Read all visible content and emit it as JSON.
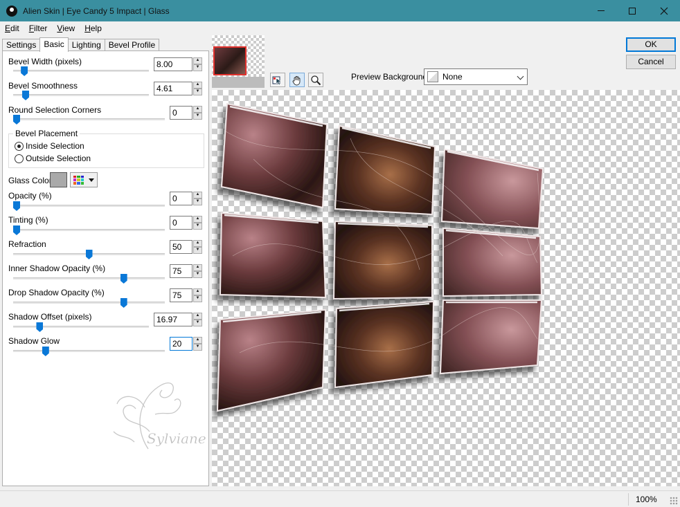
{
  "window": {
    "title": "Alien Skin | Eye Candy 5 Impact | Glass",
    "colors": {
      "titlebar": "#3a8fa0",
      "accent": "#0078d7",
      "thumb_selection": "#e2312d"
    }
  },
  "menu": [
    {
      "key": "E",
      "rest": "dit"
    },
    {
      "key": "F",
      "rest": "ilter"
    },
    {
      "key": "V",
      "rest": "iew"
    },
    {
      "key": "H",
      "rest": "elp"
    }
  ],
  "tabs": [
    "Settings",
    "Basic",
    "Lighting",
    "Bevel Profile"
  ],
  "active_tab": "Basic",
  "controls": {
    "bevel_width": {
      "label": "Bevel Width (pixels)",
      "value": "8.00",
      "level": 0.06
    },
    "bevel_smoothness": {
      "label": "Bevel Smoothness",
      "value": "4.61",
      "level": 0.07
    },
    "round_corners": {
      "label": "Round Selection Corners",
      "value": "0",
      "level": 0.0
    },
    "opacity": {
      "label": "Opacity (%)",
      "value": "0",
      "level": 0.0
    },
    "tinting": {
      "label": "Tinting (%)",
      "value": "0",
      "level": 0.0
    },
    "refraction": {
      "label": "Refraction",
      "value": "50",
      "level": 0.5
    },
    "inner_shadow": {
      "label": "Inner Shadow Opacity (%)",
      "value": "75",
      "level": 0.74
    },
    "drop_shadow": {
      "label": "Drop Shadow Opacity (%)",
      "value": "75",
      "level": 0.74
    },
    "shadow_offset": {
      "label": "Shadow Offset (pixels)",
      "value": "16.97",
      "level": 0.18
    },
    "shadow_glow": {
      "label": "Shadow Glow",
      "value": "20",
      "level": 0.2
    }
  },
  "bevel_placement": {
    "legend": "Bevel Placement",
    "options": [
      "Inside Selection",
      "Outside Selection"
    ],
    "selected": "Inside Selection"
  },
  "glass_color": {
    "label": "Glass Color",
    "value": "#a9a9a9"
  },
  "watermark_text": "Sylviane",
  "preview": {
    "background_label": "Preview Background:",
    "background_value": "None"
  },
  "buttons": {
    "ok": "OK",
    "cancel": "Cancel"
  },
  "status": {
    "zoom": "100%"
  }
}
